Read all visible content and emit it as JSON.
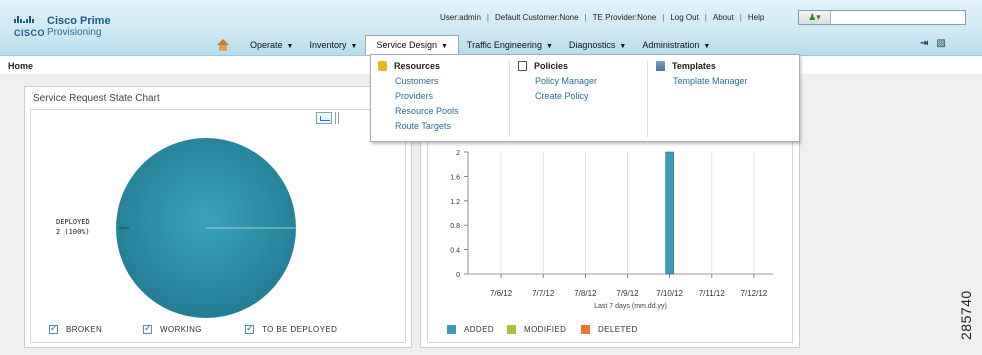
{
  "header": {
    "logo_top": "Cisco Prime",
    "logo_bottom": "Provisioning",
    "cisco_word": "CISCO",
    "user_links": [
      "User:admin",
      "Default Customer:None",
      "TE Provider:None",
      "Log Out",
      "About",
      "Help"
    ],
    "search_scope_icon": "person-icon",
    "search_value": ""
  },
  "nav": {
    "items": [
      {
        "label": "Operate",
        "caret": "▼"
      },
      {
        "label": "Inventory",
        "caret": "▼"
      },
      {
        "label": "Service Design",
        "caret": "▼"
      },
      {
        "label": "Traffic Engineering",
        "caret": "▼"
      },
      {
        "label": "Diagnostics",
        "caret": "▼"
      },
      {
        "label": "Administration",
        "caret": "▼"
      }
    ]
  },
  "breadcrumb": "Home",
  "dropdown": {
    "resources": {
      "title": "Resources",
      "items": [
        "Customers",
        "Providers",
        "Resource Pools",
        "Route Targets"
      ]
    },
    "policies": {
      "title": "Policies",
      "items": [
        "Policy Manager",
        "Create Policy"
      ]
    },
    "templates": {
      "title": "Templates",
      "items": [
        "Template Manager"
      ]
    }
  },
  "left_panel": {
    "title": "Service Request State Chart",
    "pie_label_line1": "DEPLOYED",
    "pie_label_line2": "2 (100%)",
    "legend": [
      "BROKEN",
      "WORKING",
      "TO BE DEPLOYED"
    ]
  },
  "right_panel": {
    "legend": [
      "ADDED",
      "MODIFIED",
      "DELETED"
    ]
  },
  "colors": {
    "pie": "#2e8ea5",
    "added": "#3d9cb8",
    "modified": "#9fc73a",
    "deleted": "#e8763a"
  },
  "chart_data": [
    {
      "type": "pie",
      "slices": [
        {
          "label": "DEPLOYED",
          "value": 2,
          "percent": 100
        }
      ],
      "legend": [
        "BROKEN",
        "WORKING",
        "TO BE DEPLOYED"
      ]
    },
    {
      "type": "bar",
      "categories": [
        "7/6/12",
        "7/7/12",
        "7/8/12",
        "7/9/12",
        "7/10/12",
        "7/11/12",
        "7/12/12"
      ],
      "series": [
        {
          "name": "ADDED",
          "values": [
            0,
            0,
            0,
            0,
            2,
            0,
            0
          ]
        },
        {
          "name": "MODIFIED",
          "values": [
            0,
            0,
            0,
            0,
            0,
            0,
            0
          ]
        },
        {
          "name": "DELETED",
          "values": [
            0,
            0,
            0,
            0,
            0,
            0,
            0
          ]
        }
      ],
      "xlabel": "Last 7 days (mm.dd.yy)",
      "ylabel": "",
      "yticks": [
        "0",
        "0.4",
        "0.8",
        "1.2",
        "1.6",
        "2"
      ],
      "ylim": [
        0,
        2
      ],
      "grid": true
    }
  ],
  "side_text": "285740"
}
